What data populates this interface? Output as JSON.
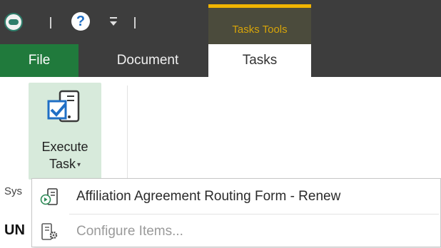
{
  "quick_access": {
    "help_glyph": "?"
  },
  "contextual_group": {
    "label": "Tasks Tools",
    "accent_color": "#f0b400"
  },
  "tabs": {
    "file": "File",
    "document": "Document",
    "tasks": "Tasks"
  },
  "ribbon": {
    "execute_task": {
      "line1": "Execute",
      "line2": "Task",
      "caret": "▾"
    }
  },
  "background_text": {
    "sys": "Sys",
    "un": "UN"
  },
  "menu": {
    "items": [
      {
        "label": "Affiliation Agreement Routing Form - Renew",
        "icon": "execute-form-icon",
        "enabled": true
      },
      {
        "label": "Configure Items...",
        "icon": "configure-gear-icon",
        "enabled": false
      }
    ]
  },
  "colors": {
    "title_bar": "#3d3d3d",
    "file_tab": "#207a3c",
    "button_highlight": "#d7eadb"
  }
}
